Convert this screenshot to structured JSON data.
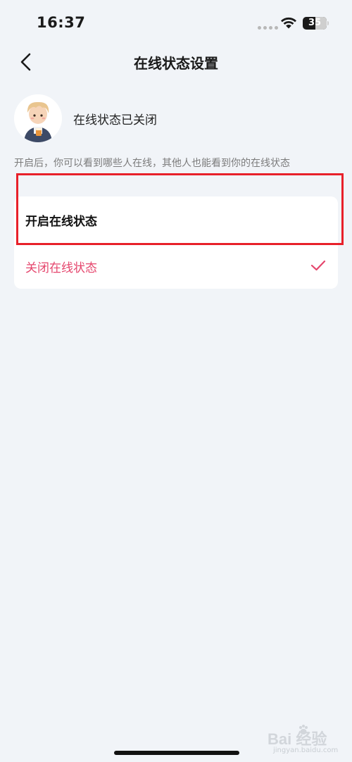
{
  "status_bar": {
    "time": "16:37",
    "battery_level": "35"
  },
  "nav": {
    "title": "在线状态设置"
  },
  "profile": {
    "status_text": "在线状态已关闭"
  },
  "description": "开启后，你可以看到哪些人在线，其他人也能看到你的在线状态",
  "options": [
    {
      "label": "开启在线状态",
      "selected": false
    },
    {
      "label": "关闭在线状态",
      "selected": true
    }
  ],
  "colors": {
    "background": "#f1f4f8",
    "accent_pink": "#e5466d",
    "highlight_red": "#e8202a"
  },
  "watermark": {
    "brand": "Bai 经验",
    "url": "jingyan.baidu.com"
  }
}
